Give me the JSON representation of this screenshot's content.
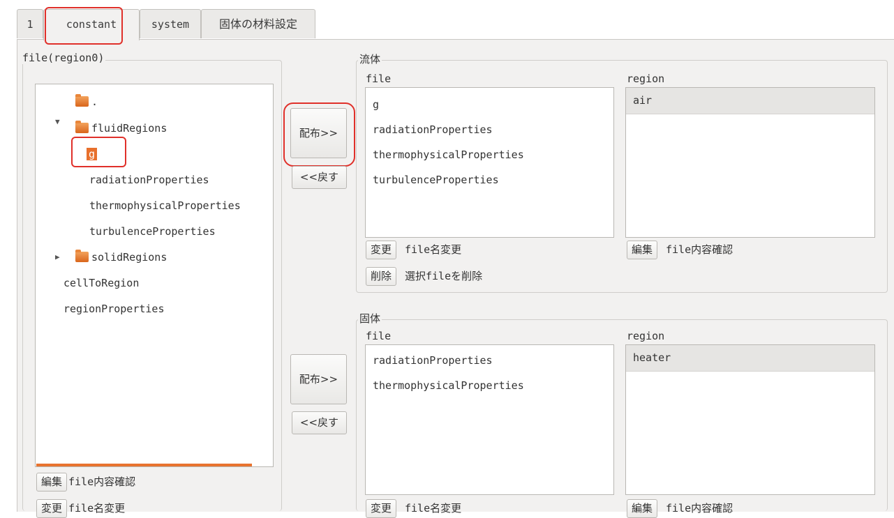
{
  "tabs": [
    "1",
    "constant",
    "system",
    "固体の材料設定"
  ],
  "left_panel": {
    "title": "file(region0)",
    "tree": [
      {
        "label": ".",
        "folder": true
      },
      {
        "label": "fluidRegions",
        "folder": true,
        "expanded": true
      },
      {
        "label": "g",
        "selected": true
      },
      {
        "label": "radiationProperties"
      },
      {
        "label": "thermophysicalProperties"
      },
      {
        "label": "turbulenceProperties"
      },
      {
        "label": "solidRegions",
        "folder": true,
        "expanded": false
      },
      {
        "label": "cellToRegion"
      },
      {
        "label": "regionProperties"
      }
    ],
    "edit_button": "編集",
    "edit_caption": "file内容確認",
    "rename_button": "変更",
    "rename_caption": "file名変更"
  },
  "fluid": {
    "title": "流体",
    "distribute_button": "配布>>",
    "back_button": "<<戻す",
    "file_header": "file",
    "region_header": "region",
    "files": [
      "g",
      "radiationProperties",
      "thermophysicalProperties",
      "turbulenceProperties"
    ],
    "regions": [
      "air"
    ],
    "rename_button": "変更",
    "rename_caption": "file名変更",
    "delete_button": "削除",
    "delete_caption": "選択fileを削除",
    "edit_button": "編集",
    "edit_caption": "file内容確認"
  },
  "solid": {
    "title": "固体",
    "distribute_button": "配布>>",
    "back_button": "<<戻す",
    "file_header": "file",
    "region_header": "region",
    "files": [
      "radiationProperties",
      "thermophysicalProperties"
    ],
    "regions": [
      "heater"
    ],
    "rename_button": "変更",
    "rename_caption": "file名変更",
    "edit_button": "編集",
    "edit_caption": "file内容確認"
  },
  "colors": {
    "highlight": "#e0302a",
    "folder": "#e07a30",
    "selection": "#e8702c"
  }
}
